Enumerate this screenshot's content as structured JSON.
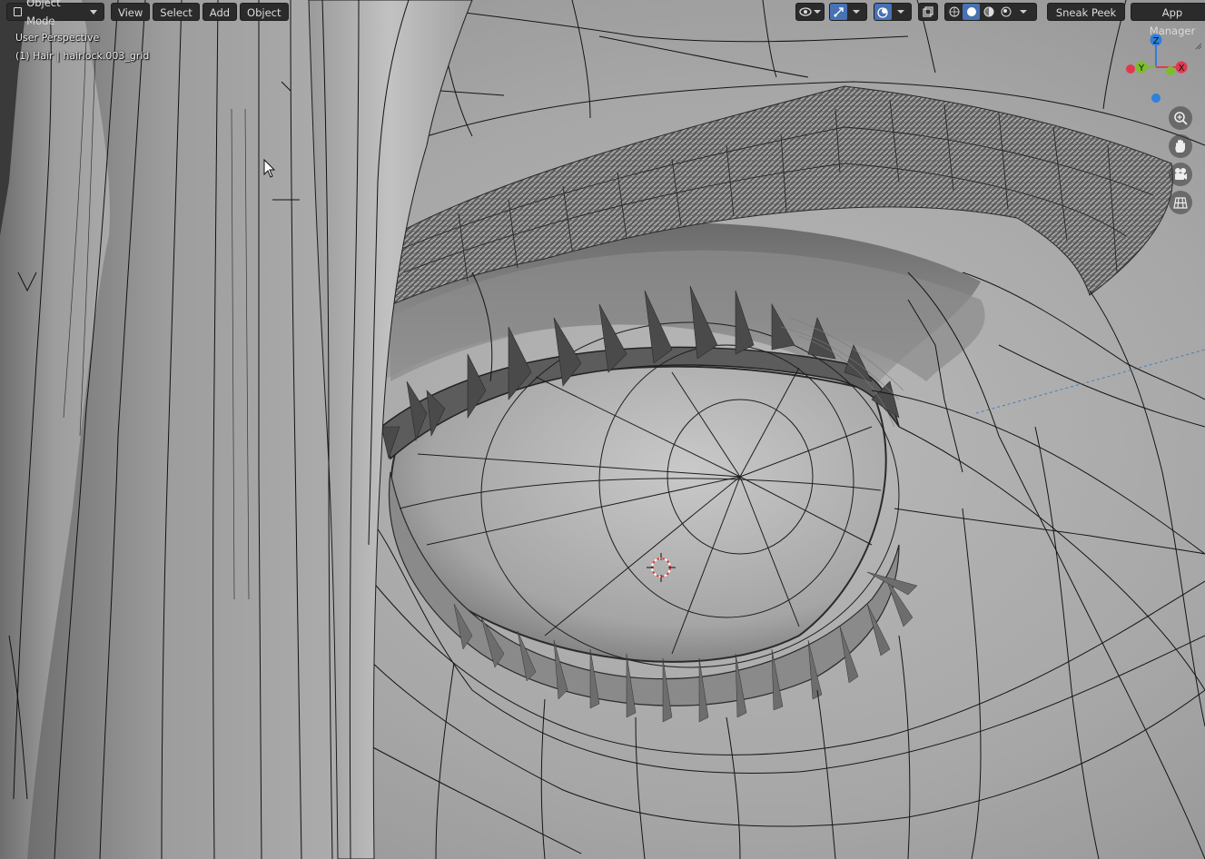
{
  "header": {
    "mode_label": "Object Mode",
    "menus": [
      {
        "label": "View"
      },
      {
        "label": "Select"
      },
      {
        "label": "Add"
      },
      {
        "label": "Object"
      }
    ],
    "right_buttons": [
      {
        "label": "Sneak Peek"
      },
      {
        "label": "App Manager"
      }
    ]
  },
  "overlay": {
    "view_name": "User Perspective",
    "object_info": "(1) Hair | hairlock.003_grid"
  },
  "gizmo": {
    "axes": [
      {
        "label": "Z",
        "color": "#2f7fdc"
      },
      {
        "label": "Y",
        "color": "#7bbd2a"
      },
      {
        "label": "X",
        "color": "#e2384f"
      }
    ]
  },
  "nav_icons": [
    "zoom-icon",
    "hand-pan-icon",
    "camera-icon",
    "grid-ortho-icon"
  ],
  "colors": {
    "accent": "#4772b3",
    "header_bg": "#2b2b2b",
    "viewport_bg": "#a8a8a8"
  }
}
